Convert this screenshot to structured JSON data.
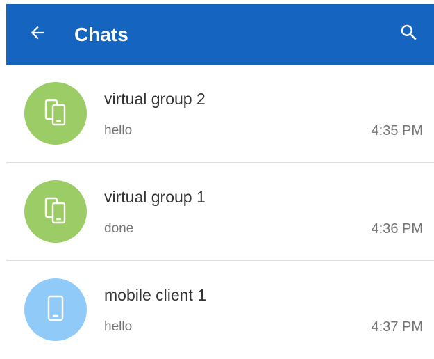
{
  "header": {
    "title": "Chats",
    "back_icon": "arrow-back-icon",
    "search_icon": "search-icon",
    "background_color": "#1565c0"
  },
  "chats": [
    {
      "name": "virtual group 2",
      "preview": "hello",
      "time": "4:35 PM",
      "avatar_icon": "devices-icon",
      "avatar_color": "#9ccc65"
    },
    {
      "name": "virtual group 1",
      "preview": "done",
      "time": "4:36 PM",
      "avatar_icon": "devices-icon",
      "avatar_color": "#9ccc65"
    },
    {
      "name": "mobile client 1",
      "preview": "hello",
      "time": "4:37 PM",
      "avatar_icon": "smartphone-icon",
      "avatar_color": "#90caf9"
    }
  ]
}
